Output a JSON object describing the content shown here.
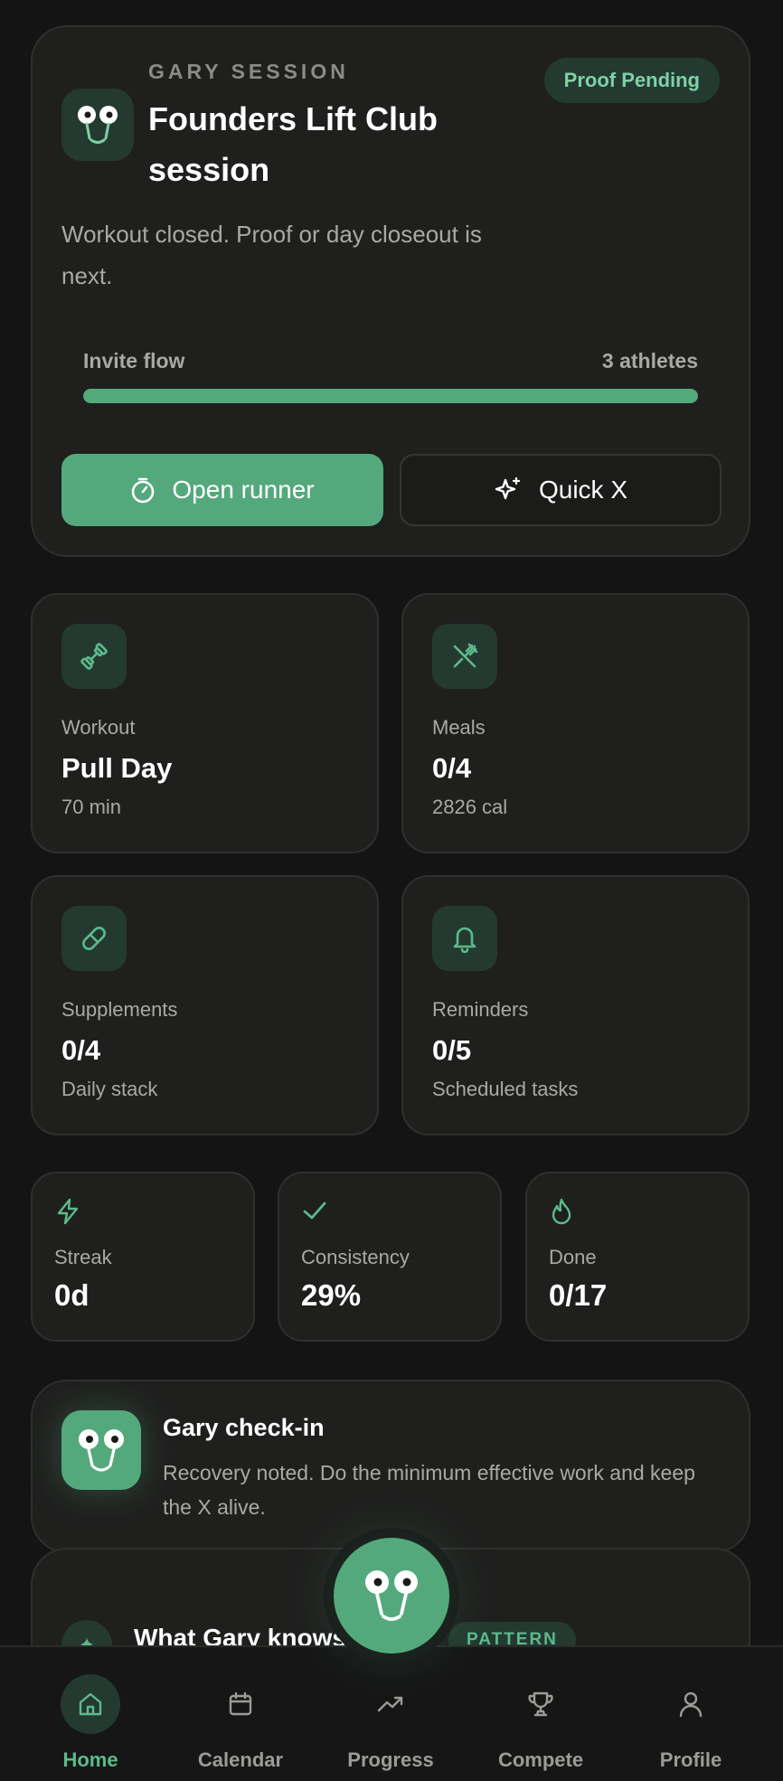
{
  "hero": {
    "eyebrow": "GARY SESSION",
    "title": "Founders Lift Club session",
    "badge": "Proof Pending",
    "body": "Workout closed. Proof or day closeout is next.",
    "flow_label": "Invite flow",
    "flow_count": "3 athletes",
    "flow_progress_percent": 100,
    "primary_button": "Open runner",
    "secondary_button": "Quick X"
  },
  "tiles": [
    {
      "label": "Workout",
      "value": "Pull Day",
      "sub": "70 min",
      "icon": "dumbbell-icon"
    },
    {
      "label": "Meals",
      "value": "0/4",
      "sub": "2826 cal",
      "icon": "utensils-icon"
    },
    {
      "label": "Supplements",
      "value": "0/4",
      "sub": "Daily stack",
      "icon": "pill-icon"
    },
    {
      "label": "Reminders",
      "value": "0/5",
      "sub": "Scheduled tasks",
      "icon": "bell-icon"
    }
  ],
  "metrics": [
    {
      "label": "Streak",
      "value": "0d",
      "icon": "bolt-icon"
    },
    {
      "label": "Consistency",
      "value": "29%",
      "icon": "check-icon"
    },
    {
      "label": "Done",
      "value": "0/17",
      "icon": "flame-icon"
    }
  ],
  "checkin": {
    "title": "Gary check-in",
    "body": "Recovery noted. Do the minimum effective work and keep the X alive."
  },
  "knows": {
    "title": "What Gary knows",
    "pill": "PATTERN"
  },
  "nav": [
    {
      "label": "Home",
      "icon": "home-icon",
      "active": true
    },
    {
      "label": "Calendar",
      "icon": "calendar-icon",
      "active": false
    },
    {
      "label": "Progress",
      "icon": "trend-icon",
      "active": false
    },
    {
      "label": "Compete",
      "icon": "trophy-icon",
      "active": false
    },
    {
      "label": "Profile",
      "icon": "profile-icon",
      "active": false
    }
  ],
  "colors": {
    "accent": "#54a97c",
    "accent_text": "#5cba8c",
    "card": "#1f1f1e",
    "background": "#141414"
  }
}
